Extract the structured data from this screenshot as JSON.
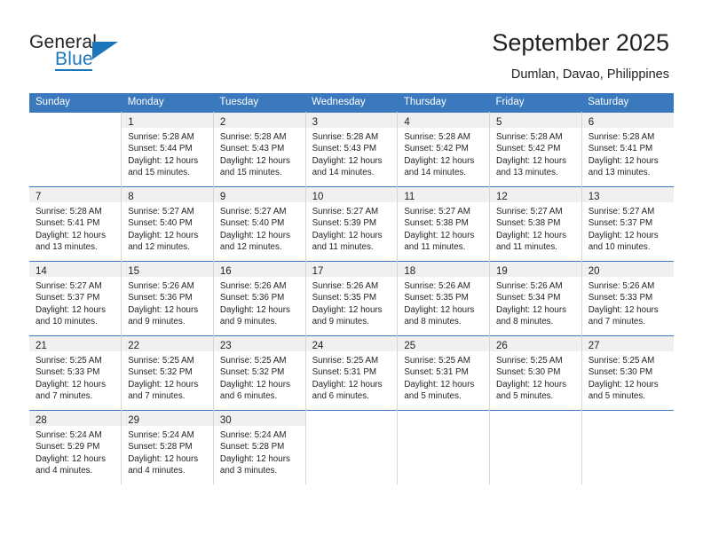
{
  "brand": {
    "name_top": "General",
    "name_bottom": "Blue",
    "accent_color": "#1b75bb"
  },
  "header": {
    "title": "September 2025",
    "subtitle": "Dumlan, Davao, Philippines"
  },
  "calendar": {
    "header_color": "#3a79bd",
    "weekday_headers": [
      "Sunday",
      "Monday",
      "Tuesday",
      "Wednesday",
      "Thursday",
      "Friday",
      "Saturday"
    ],
    "labels": {
      "sunrise_prefix": "Sunrise:",
      "sunset_prefix": "Sunset:",
      "daylight_prefix": "Daylight:"
    },
    "weeks": [
      [
        {
          "day": "",
          "lines": []
        },
        {
          "day": "1",
          "lines": [
            "Sunrise: 5:28 AM",
            "Sunset: 5:44 PM",
            "Daylight: 12 hours",
            "and 15 minutes."
          ]
        },
        {
          "day": "2",
          "lines": [
            "Sunrise: 5:28 AM",
            "Sunset: 5:43 PM",
            "Daylight: 12 hours",
            "and 15 minutes."
          ]
        },
        {
          "day": "3",
          "lines": [
            "Sunrise: 5:28 AM",
            "Sunset: 5:43 PM",
            "Daylight: 12 hours",
            "and 14 minutes."
          ]
        },
        {
          "day": "4",
          "lines": [
            "Sunrise: 5:28 AM",
            "Sunset: 5:42 PM",
            "Daylight: 12 hours",
            "and 14 minutes."
          ]
        },
        {
          "day": "5",
          "lines": [
            "Sunrise: 5:28 AM",
            "Sunset: 5:42 PM",
            "Daylight: 12 hours",
            "and 13 minutes."
          ]
        },
        {
          "day": "6",
          "lines": [
            "Sunrise: 5:28 AM",
            "Sunset: 5:41 PM",
            "Daylight: 12 hours",
            "and 13 minutes."
          ]
        }
      ],
      [
        {
          "day": "7",
          "lines": [
            "Sunrise: 5:28 AM",
            "Sunset: 5:41 PM",
            "Daylight: 12 hours",
            "and 13 minutes."
          ]
        },
        {
          "day": "8",
          "lines": [
            "Sunrise: 5:27 AM",
            "Sunset: 5:40 PM",
            "Daylight: 12 hours",
            "and 12 minutes."
          ]
        },
        {
          "day": "9",
          "lines": [
            "Sunrise: 5:27 AM",
            "Sunset: 5:40 PM",
            "Daylight: 12 hours",
            "and 12 minutes."
          ]
        },
        {
          "day": "10",
          "lines": [
            "Sunrise: 5:27 AM",
            "Sunset: 5:39 PM",
            "Daylight: 12 hours",
            "and 11 minutes."
          ]
        },
        {
          "day": "11",
          "lines": [
            "Sunrise: 5:27 AM",
            "Sunset: 5:38 PM",
            "Daylight: 12 hours",
            "and 11 minutes."
          ]
        },
        {
          "day": "12",
          "lines": [
            "Sunrise: 5:27 AM",
            "Sunset: 5:38 PM",
            "Daylight: 12 hours",
            "and 11 minutes."
          ]
        },
        {
          "day": "13",
          "lines": [
            "Sunrise: 5:27 AM",
            "Sunset: 5:37 PM",
            "Daylight: 12 hours",
            "and 10 minutes."
          ]
        }
      ],
      [
        {
          "day": "14",
          "lines": [
            "Sunrise: 5:27 AM",
            "Sunset: 5:37 PM",
            "Daylight: 12 hours",
            "and 10 minutes."
          ]
        },
        {
          "day": "15",
          "lines": [
            "Sunrise: 5:26 AM",
            "Sunset: 5:36 PM",
            "Daylight: 12 hours",
            "and 9 minutes."
          ]
        },
        {
          "day": "16",
          "lines": [
            "Sunrise: 5:26 AM",
            "Sunset: 5:36 PM",
            "Daylight: 12 hours",
            "and 9 minutes."
          ]
        },
        {
          "day": "17",
          "lines": [
            "Sunrise: 5:26 AM",
            "Sunset: 5:35 PM",
            "Daylight: 12 hours",
            "and 9 minutes."
          ]
        },
        {
          "day": "18",
          "lines": [
            "Sunrise: 5:26 AM",
            "Sunset: 5:35 PM",
            "Daylight: 12 hours",
            "and 8 minutes."
          ]
        },
        {
          "day": "19",
          "lines": [
            "Sunrise: 5:26 AM",
            "Sunset: 5:34 PM",
            "Daylight: 12 hours",
            "and 8 minutes."
          ]
        },
        {
          "day": "20",
          "lines": [
            "Sunrise: 5:26 AM",
            "Sunset: 5:33 PM",
            "Daylight: 12 hours",
            "and 7 minutes."
          ]
        }
      ],
      [
        {
          "day": "21",
          "lines": [
            "Sunrise: 5:25 AM",
            "Sunset: 5:33 PM",
            "Daylight: 12 hours",
            "and 7 minutes."
          ]
        },
        {
          "day": "22",
          "lines": [
            "Sunrise: 5:25 AM",
            "Sunset: 5:32 PM",
            "Daylight: 12 hours",
            "and 7 minutes."
          ]
        },
        {
          "day": "23",
          "lines": [
            "Sunrise: 5:25 AM",
            "Sunset: 5:32 PM",
            "Daylight: 12 hours",
            "and 6 minutes."
          ]
        },
        {
          "day": "24",
          "lines": [
            "Sunrise: 5:25 AM",
            "Sunset: 5:31 PM",
            "Daylight: 12 hours",
            "and 6 minutes."
          ]
        },
        {
          "day": "25",
          "lines": [
            "Sunrise: 5:25 AM",
            "Sunset: 5:31 PM",
            "Daylight: 12 hours",
            "and 5 minutes."
          ]
        },
        {
          "day": "26",
          "lines": [
            "Sunrise: 5:25 AM",
            "Sunset: 5:30 PM",
            "Daylight: 12 hours",
            "and 5 minutes."
          ]
        },
        {
          "day": "27",
          "lines": [
            "Sunrise: 5:25 AM",
            "Sunset: 5:30 PM",
            "Daylight: 12 hours",
            "and 5 minutes."
          ]
        }
      ],
      [
        {
          "day": "28",
          "lines": [
            "Sunrise: 5:24 AM",
            "Sunset: 5:29 PM",
            "Daylight: 12 hours",
            "and 4 minutes."
          ]
        },
        {
          "day": "29",
          "lines": [
            "Sunrise: 5:24 AM",
            "Sunset: 5:28 PM",
            "Daylight: 12 hours",
            "and 4 minutes."
          ]
        },
        {
          "day": "30",
          "lines": [
            "Sunrise: 5:24 AM",
            "Sunset: 5:28 PM",
            "Daylight: 12 hours",
            "and 3 minutes."
          ]
        },
        {
          "day": "",
          "lines": []
        },
        {
          "day": "",
          "lines": []
        },
        {
          "day": "",
          "lines": []
        },
        {
          "day": "",
          "lines": []
        }
      ]
    ]
  }
}
